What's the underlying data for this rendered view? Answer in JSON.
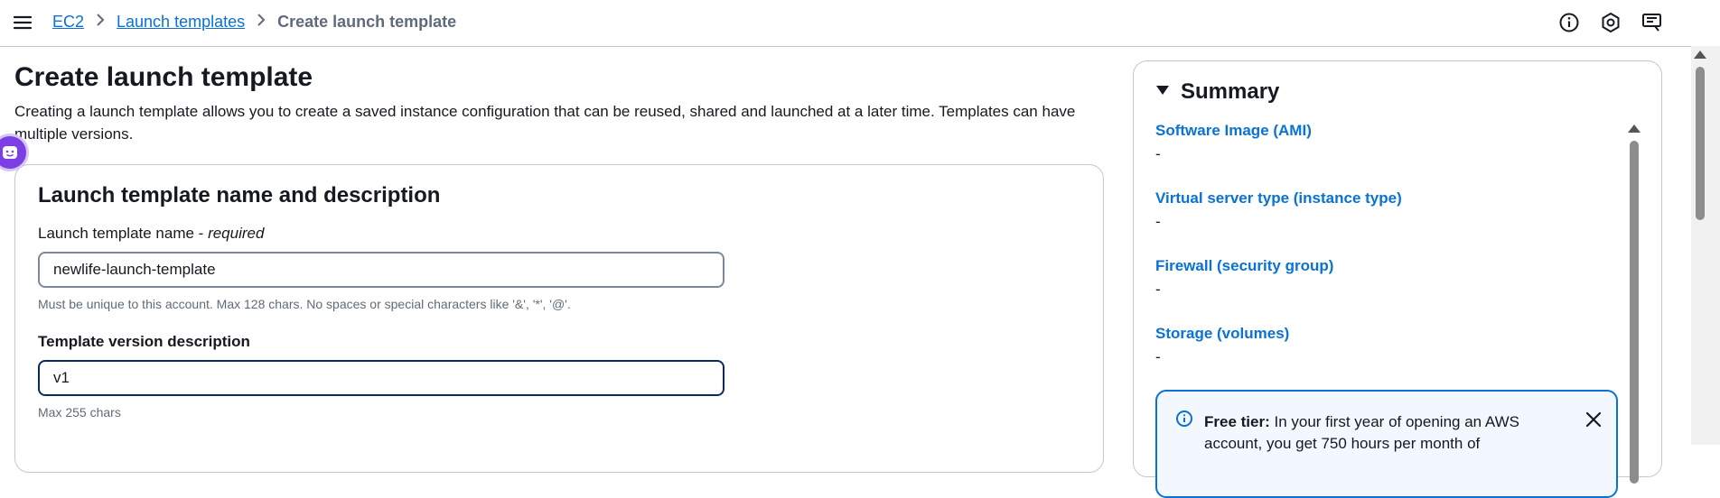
{
  "breadcrumb": {
    "items": [
      {
        "label": "EC2"
      },
      {
        "label": "Launch templates"
      },
      {
        "label": "Create launch template"
      }
    ]
  },
  "header_icons": [
    "info-icon",
    "settings-hex-icon",
    "feedback-screen-icon"
  ],
  "page": {
    "title": "Create launch template",
    "description": "Creating a launch template allows you to create a saved instance configuration that can be reused, shared and launched at a later time. Templates can have multiple versions."
  },
  "name_section": {
    "title": "Launch template name and description",
    "name_label": "Launch template name - ",
    "name_required": "required",
    "name_value": "newlife-launch-template",
    "name_hint": "Must be unique to this account. Max 128 chars. No spaces or special characters like '&', '*', '@'.",
    "desc_label": "Template version description",
    "desc_value": "v1",
    "desc_hint": "Max 255 chars"
  },
  "summary": {
    "title": "Summary",
    "items": [
      {
        "label": "Software Image (AMI)",
        "value": "-"
      },
      {
        "label": "Virtual server type (instance type)",
        "value": "-"
      },
      {
        "label": "Firewall (security group)",
        "value": "-"
      },
      {
        "label": "Storage (volumes)",
        "value": "-"
      }
    ],
    "alert": {
      "bold": "Free tier:",
      "text": " In your first year of opening an AWS account, you get 750 hours per month of"
    }
  },
  "colors": {
    "link": "#0972d3",
    "text": "#16191f",
    "muted": "#5f6b7a",
    "alert_border": "#0972d3"
  }
}
